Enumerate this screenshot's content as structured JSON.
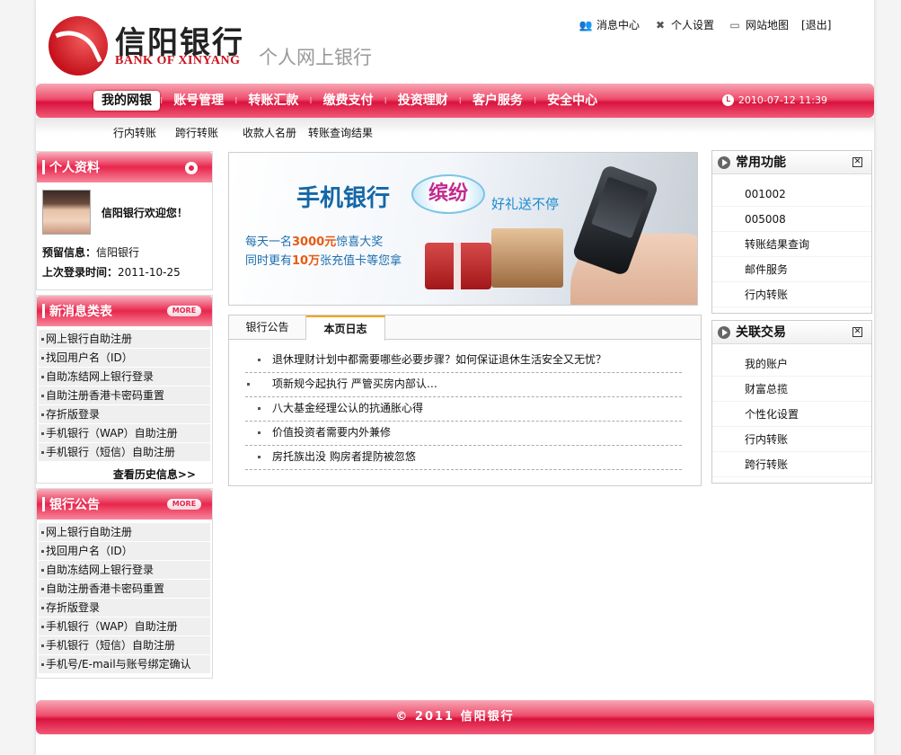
{
  "header": {
    "logo_cn": "信阳银行",
    "logo_en": "BANK OF XINYANG",
    "subtitle": "个人网上银行",
    "links": [
      {
        "label": "消息中心",
        "icon": "message-icon"
      },
      {
        "label": "个人设置",
        "icon": "settings-icon"
      },
      {
        "label": "网站地图",
        "icon": "monitor-icon"
      },
      {
        "label": "[退出]",
        "icon": ""
      }
    ]
  },
  "nav": {
    "items": [
      "我的网银",
      "账号管理",
      "转账汇款",
      "缴费支付",
      "投资理财",
      "客户服务",
      "安全中心"
    ],
    "active": "我的网银",
    "time": "2010-07-12 11:39"
  },
  "subnav": {
    "items": [
      "行内转账",
      "跨行转账",
      "收款人名册",
      "转账查询结果"
    ]
  },
  "profile": {
    "title": "个人资料",
    "welcome": "信阳银行欢迎您！",
    "reserved_label": "预留信息：",
    "reserved_value": "信阳银行",
    "last_login_label": "上次登录时间：",
    "last_login_value": "2011-10-25"
  },
  "messages": {
    "title": "新消息类表",
    "more": "MORE",
    "items": [
      "网上银行自助注册",
      "找回用户名（ID）",
      "自助冻结网上银行登录",
      "自助注册香港卡密码重置",
      "存折版登录",
      "手机银行（WAP）自助注册",
      "手机银行（短信）自助注册"
    ],
    "history": "查看历史信息>>"
  },
  "announcements": {
    "title": "银行公告",
    "more": "MORE",
    "items": [
      "网上银行自助注册",
      "找回用户名（ID）",
      "自助冻结网上银行登录",
      "自助注册香港卡密码重置",
      "存折版登录",
      "手机银行（WAP）自助注册",
      "手机银行（短信）自助注册",
      "手机号/E-mail与账号绑定确认"
    ]
  },
  "banner": {
    "title": "手机银行",
    "bubble": "缤纷",
    "tagline": "好礼送不停",
    "line1_a": "每天一名",
    "line1_em": "3000元",
    "line1_b": "惊喜大奖",
    "line2_a": "同时更有",
    "line2_em": "10万",
    "line2_b": "张充值卡等您拿"
  },
  "tabs": {
    "labels": [
      "银行公告",
      "本页日志"
    ],
    "active": "本页日志",
    "news": [
      "退休理财计划中都需要哪些必要步骤？如何保证退休生活安全又无忧？",
      "项新规今起执行 严管买房内部认…",
      "八大基金经理公认的抗通胀心得",
      "价值投资者需要内外兼修",
      "房托族出没 购房者提防被忽悠"
    ]
  },
  "common_functions": {
    "title": "常用功能",
    "items": [
      "001002",
      "005008",
      "转账结果查询",
      "邮件服务",
      "行内转账"
    ]
  },
  "related": {
    "title": "关联交易",
    "items": [
      "我的账户",
      "财富总揽",
      "个性化设置",
      "行内转账",
      "跨行转账"
    ]
  },
  "footer": {
    "text": "© 2011 信阳银行"
  },
  "colors": {
    "brand_red": "#d9123d",
    "accent_orange": "#f4a51c"
  }
}
